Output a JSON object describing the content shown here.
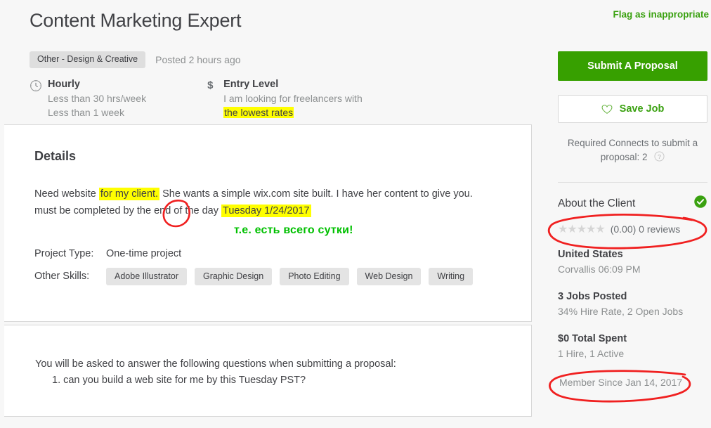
{
  "header": {
    "title": "Content Marketing Expert",
    "category_tag": "Other - Design & Creative",
    "posted": "Posted 2 hours ago",
    "flag_link": "Flag as inappropriate"
  },
  "facts": {
    "schedule": {
      "icon": "clock-icon",
      "title": "Hourly",
      "sub1": "Less than 30 hrs/week",
      "sub2": "Less than 1 week"
    },
    "budget": {
      "icon": "dollar-icon",
      "title": "Entry Level",
      "sub1": "I am looking for freelancers with",
      "sub2_highlighted": "the lowest rates"
    }
  },
  "details": {
    "section_title": "Details",
    "desc_line1_a": "Need website ",
    "desc_line1_hl": "for my client.",
    "desc_line1_b": " She wants a simple wix.com site built. I have her content to give you.",
    "desc_line2_a": "must be completed by the end of the day ",
    "desc_line2_hl": "Tuesday 1/24/2017",
    "annotation_note": "т.е. есть всего сутки!",
    "project_type_label": "Project Type:",
    "project_type_value": "One-time project",
    "other_skills_label": "Other Skills:",
    "skills": [
      "Adobe Illustrator",
      "Graphic Design",
      "Photo Editing",
      "Web Design",
      "Writing"
    ]
  },
  "questions": {
    "intro": "You will be asked to answer the following questions when submitting a proposal:",
    "items": [
      "1. can you build a web site for me by this Tuesday PST?"
    ]
  },
  "sidebar": {
    "submit_button": "Submit A Proposal",
    "save_button": "Save Job",
    "save_icon": "heart-icon",
    "connects_text": "Required Connects to submit a proposal: 2",
    "connects_help_icon": "help-circle-icon",
    "client": {
      "heading": "About the Client",
      "verified_icon": "verified-check-icon",
      "stars": 5,
      "stars_filled": 0,
      "rating_text": "(0.00) 0 reviews",
      "country": "United States",
      "local_time": "Corvallis 06:09 PM",
      "jobs_posted": "3 Jobs Posted",
      "hire_rate": "34% Hire Rate, 2 Open Jobs",
      "total_spent": "$0 Total Spent",
      "hires": "1 Hire, 1 Active",
      "member_since": "Member Since Jan 14, 2017"
    }
  },
  "annotations": {
    "color": "#f02020",
    "highlight_color": "#ffff00",
    "note_color": "#00c000",
    "shapes": [
      "circle-around-she",
      "ellipse-around-rating",
      "ellipse-around-member-since"
    ]
  }
}
